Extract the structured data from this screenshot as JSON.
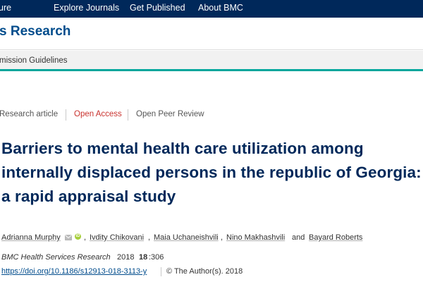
{
  "topnav": {
    "brand_fragment": "ure",
    "items": [
      "Explore Journals",
      "Get Published",
      "About BMC"
    ]
  },
  "journal": {
    "title_fragment": "s Research"
  },
  "subnav": {
    "item_fragment": "mission Guidelines"
  },
  "article_meta": {
    "type": "Research article",
    "access": "Open Access",
    "review": "Open Peer Review"
  },
  "article": {
    "title": "Barriers to mental health care utilization among internally displaced persons in the republic of Georgia: a rapid appraisal study"
  },
  "authors": [
    {
      "name": "Adrianna Murphy",
      "sep": ""
    },
    {
      "name": "Ivdity Chikovani",
      "sep": ","
    },
    {
      "name": "Maia Uchaneishvili",
      "sep": ","
    },
    {
      "name": "Nino Makhashvili",
      "sep": ","
    },
    {
      "name": "Bayard Roberts",
      "sep": "and"
    }
  ],
  "citation": {
    "journal": "BMC Health Services Research",
    "year": "2018",
    "volume": "18",
    "article_number": ":306",
    "doi": "https://doi.org/10.1186/s12913-018-3113-y",
    "copyright": "©  The Author(s). 2018"
  },
  "colors": {
    "nav_bg": "#00285a",
    "journal_blue": "#014c8c",
    "open_access_red": "#c9322e",
    "teal_accent": "#00a69c",
    "orcid_green": "#a6ce39"
  },
  "icons": {
    "mail": "mail-icon",
    "orcid": "orcid-icon"
  }
}
